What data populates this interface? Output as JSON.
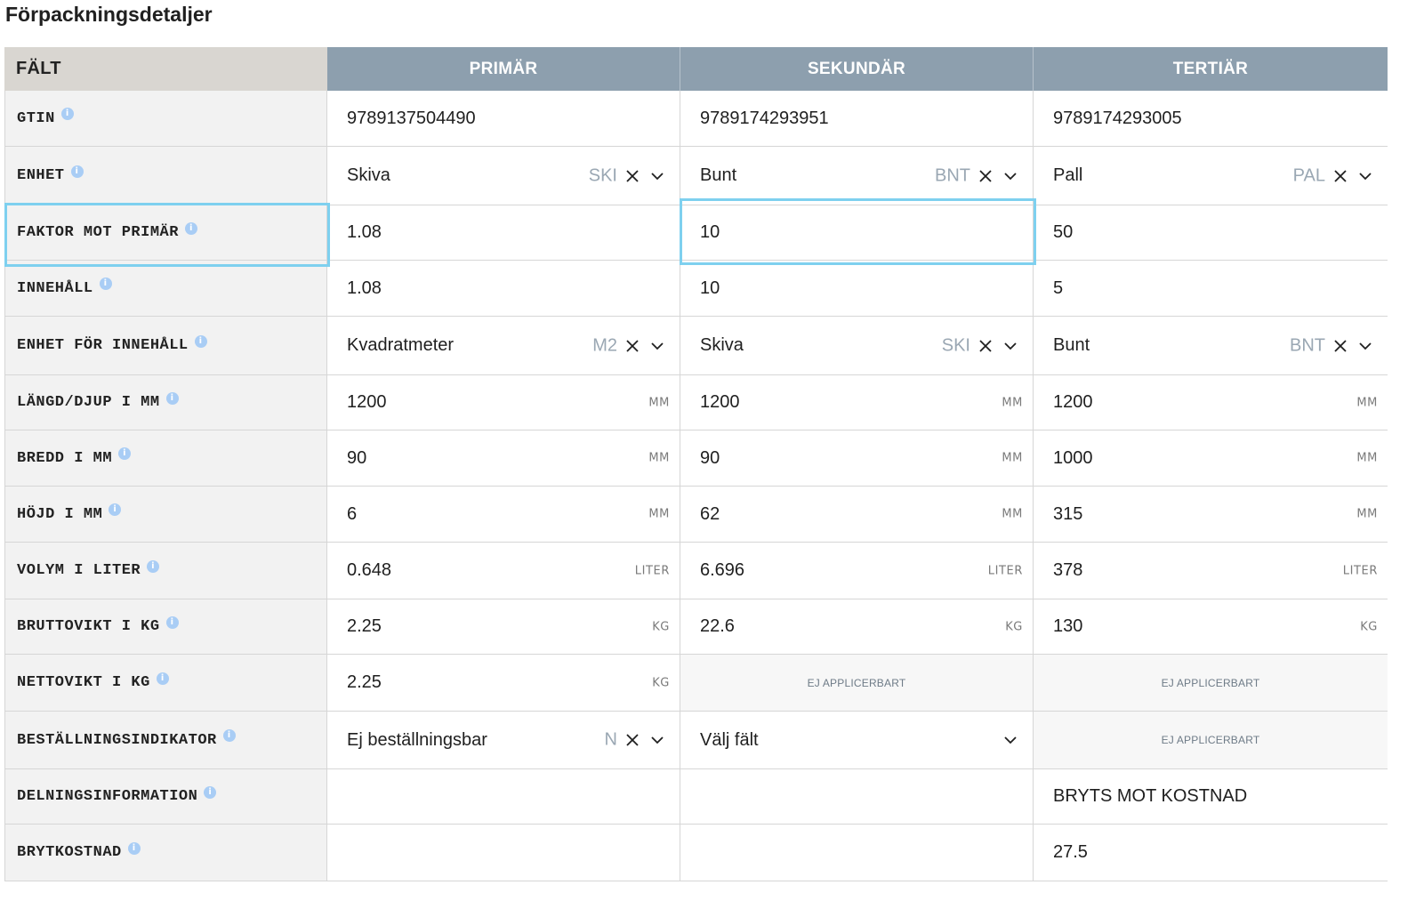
{
  "page": {
    "title": "Förpackningsdetaljer"
  },
  "header": {
    "field": "FÄLT",
    "primary": "PRIMÄR",
    "secondary": "SEKUNDÄR",
    "tertiary": "TERTIÄR"
  },
  "info_icon_glyph": "i",
  "rows": [
    {
      "label": "GTIN",
      "cells": [
        {
          "type": "text",
          "value": "9789137504490"
        },
        {
          "type": "text",
          "value": "9789174293951"
        },
        {
          "type": "text",
          "value": "9789174293005"
        }
      ]
    },
    {
      "label": "ENHET",
      "cells": [
        {
          "type": "select",
          "value": "Skiva",
          "code": "SKI"
        },
        {
          "type": "select",
          "value": "Bunt",
          "code": "BNT"
        },
        {
          "type": "select",
          "value": "Pall",
          "code": "PAL"
        }
      ]
    },
    {
      "label": "FAKTOR MOT PRIMÄR",
      "cells": [
        {
          "type": "text",
          "value": "1.08"
        },
        {
          "type": "text",
          "value": "10"
        },
        {
          "type": "text",
          "value": "50"
        }
      ]
    },
    {
      "label": "INNEHÅLL",
      "cells": [
        {
          "type": "text",
          "value": "1.08"
        },
        {
          "type": "text",
          "value": "10"
        },
        {
          "type": "text",
          "value": "5"
        }
      ]
    },
    {
      "label": "ENHET FÖR INNEHÅLL",
      "cells": [
        {
          "type": "select",
          "value": "Kvadratmeter",
          "code": "M2"
        },
        {
          "type": "select",
          "value": "Skiva",
          "code": "SKI"
        },
        {
          "type": "select",
          "value": "Bunt",
          "code": "BNT"
        }
      ]
    },
    {
      "label": "LÄNGD/DJUP I MM",
      "cells": [
        {
          "type": "unit",
          "value": "1200",
          "unit": "MM"
        },
        {
          "type": "unit",
          "value": "1200",
          "unit": "MM"
        },
        {
          "type": "unit",
          "value": "1200",
          "unit": "MM"
        }
      ]
    },
    {
      "label": "BREDD I MM",
      "cells": [
        {
          "type": "unit",
          "value": "90",
          "unit": "MM"
        },
        {
          "type": "unit",
          "value": "90",
          "unit": "MM"
        },
        {
          "type": "unit",
          "value": "1000",
          "unit": "MM"
        }
      ]
    },
    {
      "label": "HÖJD I MM",
      "cells": [
        {
          "type": "unit",
          "value": "6",
          "unit": "MM"
        },
        {
          "type": "unit",
          "value": "62",
          "unit": "MM"
        },
        {
          "type": "unit",
          "value": "315",
          "unit": "MM"
        }
      ]
    },
    {
      "label": "VOLYM I LITER",
      "cells": [
        {
          "type": "unit",
          "value": "0.648",
          "unit": "LITER"
        },
        {
          "type": "unit",
          "value": "6.696",
          "unit": "LITER"
        },
        {
          "type": "unit",
          "value": "378",
          "unit": "LITER"
        }
      ]
    },
    {
      "label": "BRUTTOVIKT I KG",
      "cells": [
        {
          "type": "unit",
          "value": "2.25",
          "unit": "KG"
        },
        {
          "type": "unit",
          "value": "22.6",
          "unit": "KG"
        },
        {
          "type": "unit",
          "value": "130",
          "unit": "KG"
        }
      ]
    },
    {
      "label": "NETTOVIKT I KG",
      "cells": [
        {
          "type": "unit",
          "value": "2.25",
          "unit": "KG"
        },
        {
          "type": "na",
          "value": "EJ APPLICERBART"
        },
        {
          "type": "na",
          "value": "EJ APPLICERBART"
        }
      ]
    },
    {
      "label": "BESTÄLLNINGSINDIKATOR",
      "cells": [
        {
          "type": "select",
          "value": "Ej beställningsbar",
          "code": "N"
        },
        {
          "type": "placeholder-select",
          "value": "Välj fält"
        },
        {
          "type": "na",
          "value": "EJ APPLICERBART"
        }
      ]
    },
    {
      "label": "DELNINGSINFORMATION",
      "cells": [
        {
          "type": "empty",
          "value": ""
        },
        {
          "type": "empty",
          "value": ""
        },
        {
          "type": "text",
          "value": "BRYTS MOT KOSTNAD"
        }
      ]
    },
    {
      "label": "BRYTKOSTNAD",
      "cells": [
        {
          "type": "empty",
          "value": ""
        },
        {
          "type": "empty",
          "value": ""
        },
        {
          "type": "text",
          "value": "27.5"
        }
      ]
    }
  ],
  "colors": {
    "header_bg": "#8d9fae",
    "field_header_bg": "#d9d6d1",
    "label_bg": "#f2f2f2",
    "highlight": "#7ed0ef",
    "info_icon": "#a9cdf5",
    "code_text": "#9aa7b3"
  }
}
